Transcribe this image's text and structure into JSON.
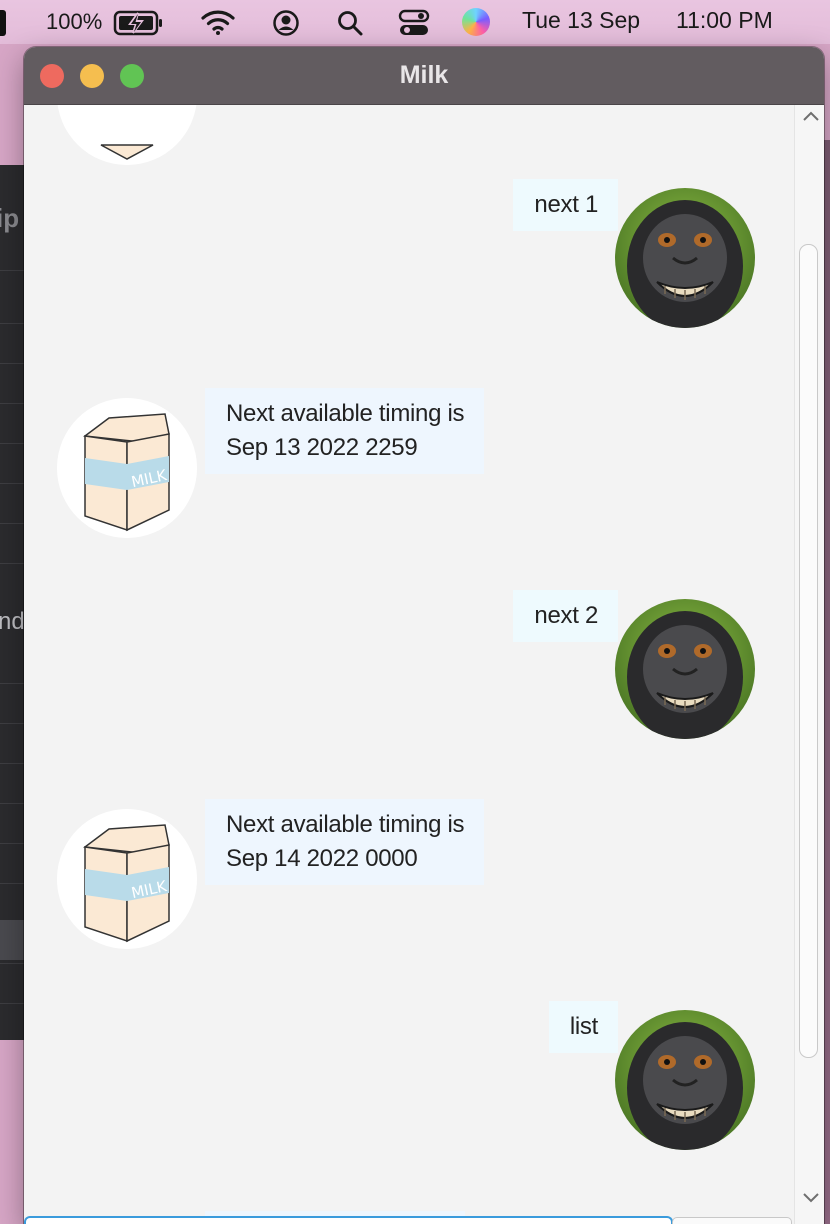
{
  "menubar": {
    "battery_percent": "100%",
    "date": "Tue 13 Sep",
    "time": "11:00 PM"
  },
  "background_app": {
    "partial_label_1": "ip",
    "partial_label_2": "nd"
  },
  "window": {
    "title": "Milk"
  },
  "chat": {
    "messages": [
      {
        "sender": "user",
        "text": "next 1"
      },
      {
        "sender": "bot",
        "line1": "Next available timing is",
        "line2": "Sep 13 2022 2259"
      },
      {
        "sender": "user",
        "text": "next 2"
      },
      {
        "sender": "bot",
        "line1": "Next available timing is",
        "line2": "Sep 14 2022 0000"
      },
      {
        "sender": "user",
        "text": "list"
      }
    ],
    "bot_avatar_label": "MILK"
  },
  "colors": {
    "titlebar": "#625c60",
    "chat_background": "#f3f3f3",
    "bubble": "#eef7ff",
    "traffic_red": "#ee6a5f",
    "traffic_yellow": "#f5be4f",
    "traffic_green": "#61c454"
  },
  "icons": [
    "battery-charging-icon",
    "wifi-icon",
    "user-account-icon",
    "search-icon",
    "control-center-icon",
    "siri-icon",
    "scroll-up-icon",
    "scroll-down-icon"
  ]
}
